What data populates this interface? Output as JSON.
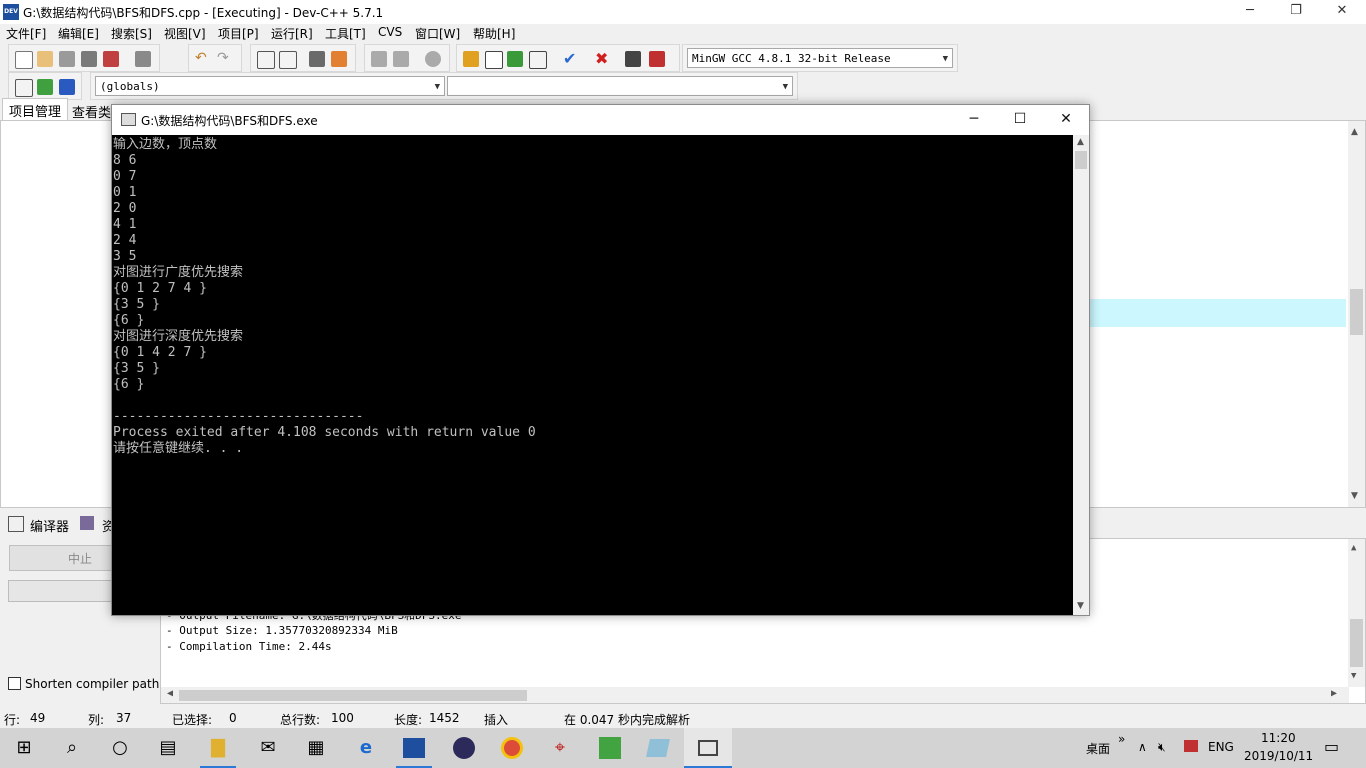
{
  "window": {
    "title": "G:\\数据结构代码\\BFS和DFS.cpp - [Executing] - Dev-C++ 5.7.1",
    "app_icon_text": "DEV",
    "minimize": "─",
    "restore": "❐",
    "close": "✕"
  },
  "menu": [
    "文件[F]",
    "编辑[E]",
    "搜索[S]",
    "视图[V]",
    "项目[P]",
    "运行[R]",
    "工具[T]",
    "CVS",
    "窗口[W]",
    "帮助[H]"
  ],
  "toolbar": {
    "compiler_select": "MinGW GCC 4.8.1 32-bit Release",
    "scope_select": "(globals)",
    "member_select": ""
  },
  "left_tabs": [
    "项目管理",
    "查看类"
  ],
  "bottom_tabs": [
    "编译器",
    "资"
  ],
  "bottom": {
    "abort_label": "中止",
    "shorten_label": "Shorten compiler paths",
    "log_lines": [
      "- Output Filename: G:\\数据结构代码\\BFS和DFS.exe",
      "- Output Size: 1.35770320892334 MiB",
      "- Compilation Time: 2.44s"
    ]
  },
  "status": {
    "row_label": "行:",
    "row_value": "49",
    "col_label": "列:",
    "col_value": "37",
    "sel_label": "已选择:",
    "sel_value": "0",
    "total_label": "总行数:",
    "total_value": "100",
    "len_label": "长度:",
    "len_value": "1452",
    "mode": "插入",
    "parse_msg": "在 0.047 秒内完成解析"
  },
  "console": {
    "title": "G:\\数据结构代码\\BFS和DFS.exe",
    "lines": [
      "输入边数，顶点数",
      "8 6",
      "0 7",
      "0 1",
      "2 0",
      "4 1",
      "2 4",
      "3 5",
      "对图进行广度优先搜索",
      "{0 1 2 7 4 }",
      "{3 5 }",
      "{6 }",
      "对图进行深度优先搜索",
      "{0 1 4 2 7 }",
      "{3 5 }",
      "{6 }",
      "",
      "--------------------------------",
      "Process exited after 4.108 seconds with return value 0",
      "请按任意键继续. . ."
    ]
  },
  "taskbar": {
    "items": [
      "start-icon",
      "search-icon",
      "task-view-icon",
      "task-view-timeline-icon",
      "file-explorer-icon",
      "mail-icon",
      "calculator-icon",
      "edge-icon",
      "devcpp-icon",
      "eclipse-icon",
      "chrome-icon",
      "acrobat-icon",
      "qt-icon",
      "notepad-icon",
      "console-icon"
    ],
    "desktop_label": "桌面",
    "chevron": "»",
    "lang": "ENG",
    "time": "11:20",
    "date": "2019/10/11"
  }
}
